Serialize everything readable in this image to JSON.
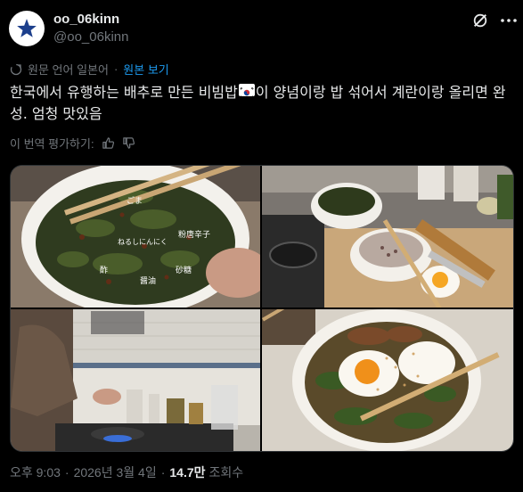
{
  "author": {
    "display_name": "oo_06kinn",
    "handle": "@oo_06kinn"
  },
  "translation": {
    "label": "원문 언어 일본어",
    "show_original": "원본 보기"
  },
  "tweet": {
    "text_before_flag": "한국에서 유행하는 배추로 만든 비빔밥",
    "text_after_flag": "이 양념이랑 밥 섞어서 계란이랑 올리면 완성. 엄청 맛있음",
    "flag_emoji": "korea-flag"
  },
  "rate_translation": {
    "label": "이 번역 평가하기:"
  },
  "photos": [
    {
      "name": "seasoned-greens-bowl",
      "overlay_labels": [
        "ごま",
        "粉唐辛子",
        "ねるしにんにく",
        "酢",
        "醤油",
        "砂糖"
      ]
    },
    {
      "name": "kitchen-counter-rice"
    },
    {
      "name": "stove-cooking"
    },
    {
      "name": "bibimbap-egg"
    }
  ],
  "footer": {
    "time": "오후 9:03",
    "date": "2026년 3월 4일",
    "views_count": "14.7만",
    "views_label": "조회수"
  },
  "colors": {
    "background": "#000000",
    "text": "#e7e9ea",
    "secondary": "#71767b",
    "accent": "#1d9bf0",
    "border": "#2f3336"
  }
}
